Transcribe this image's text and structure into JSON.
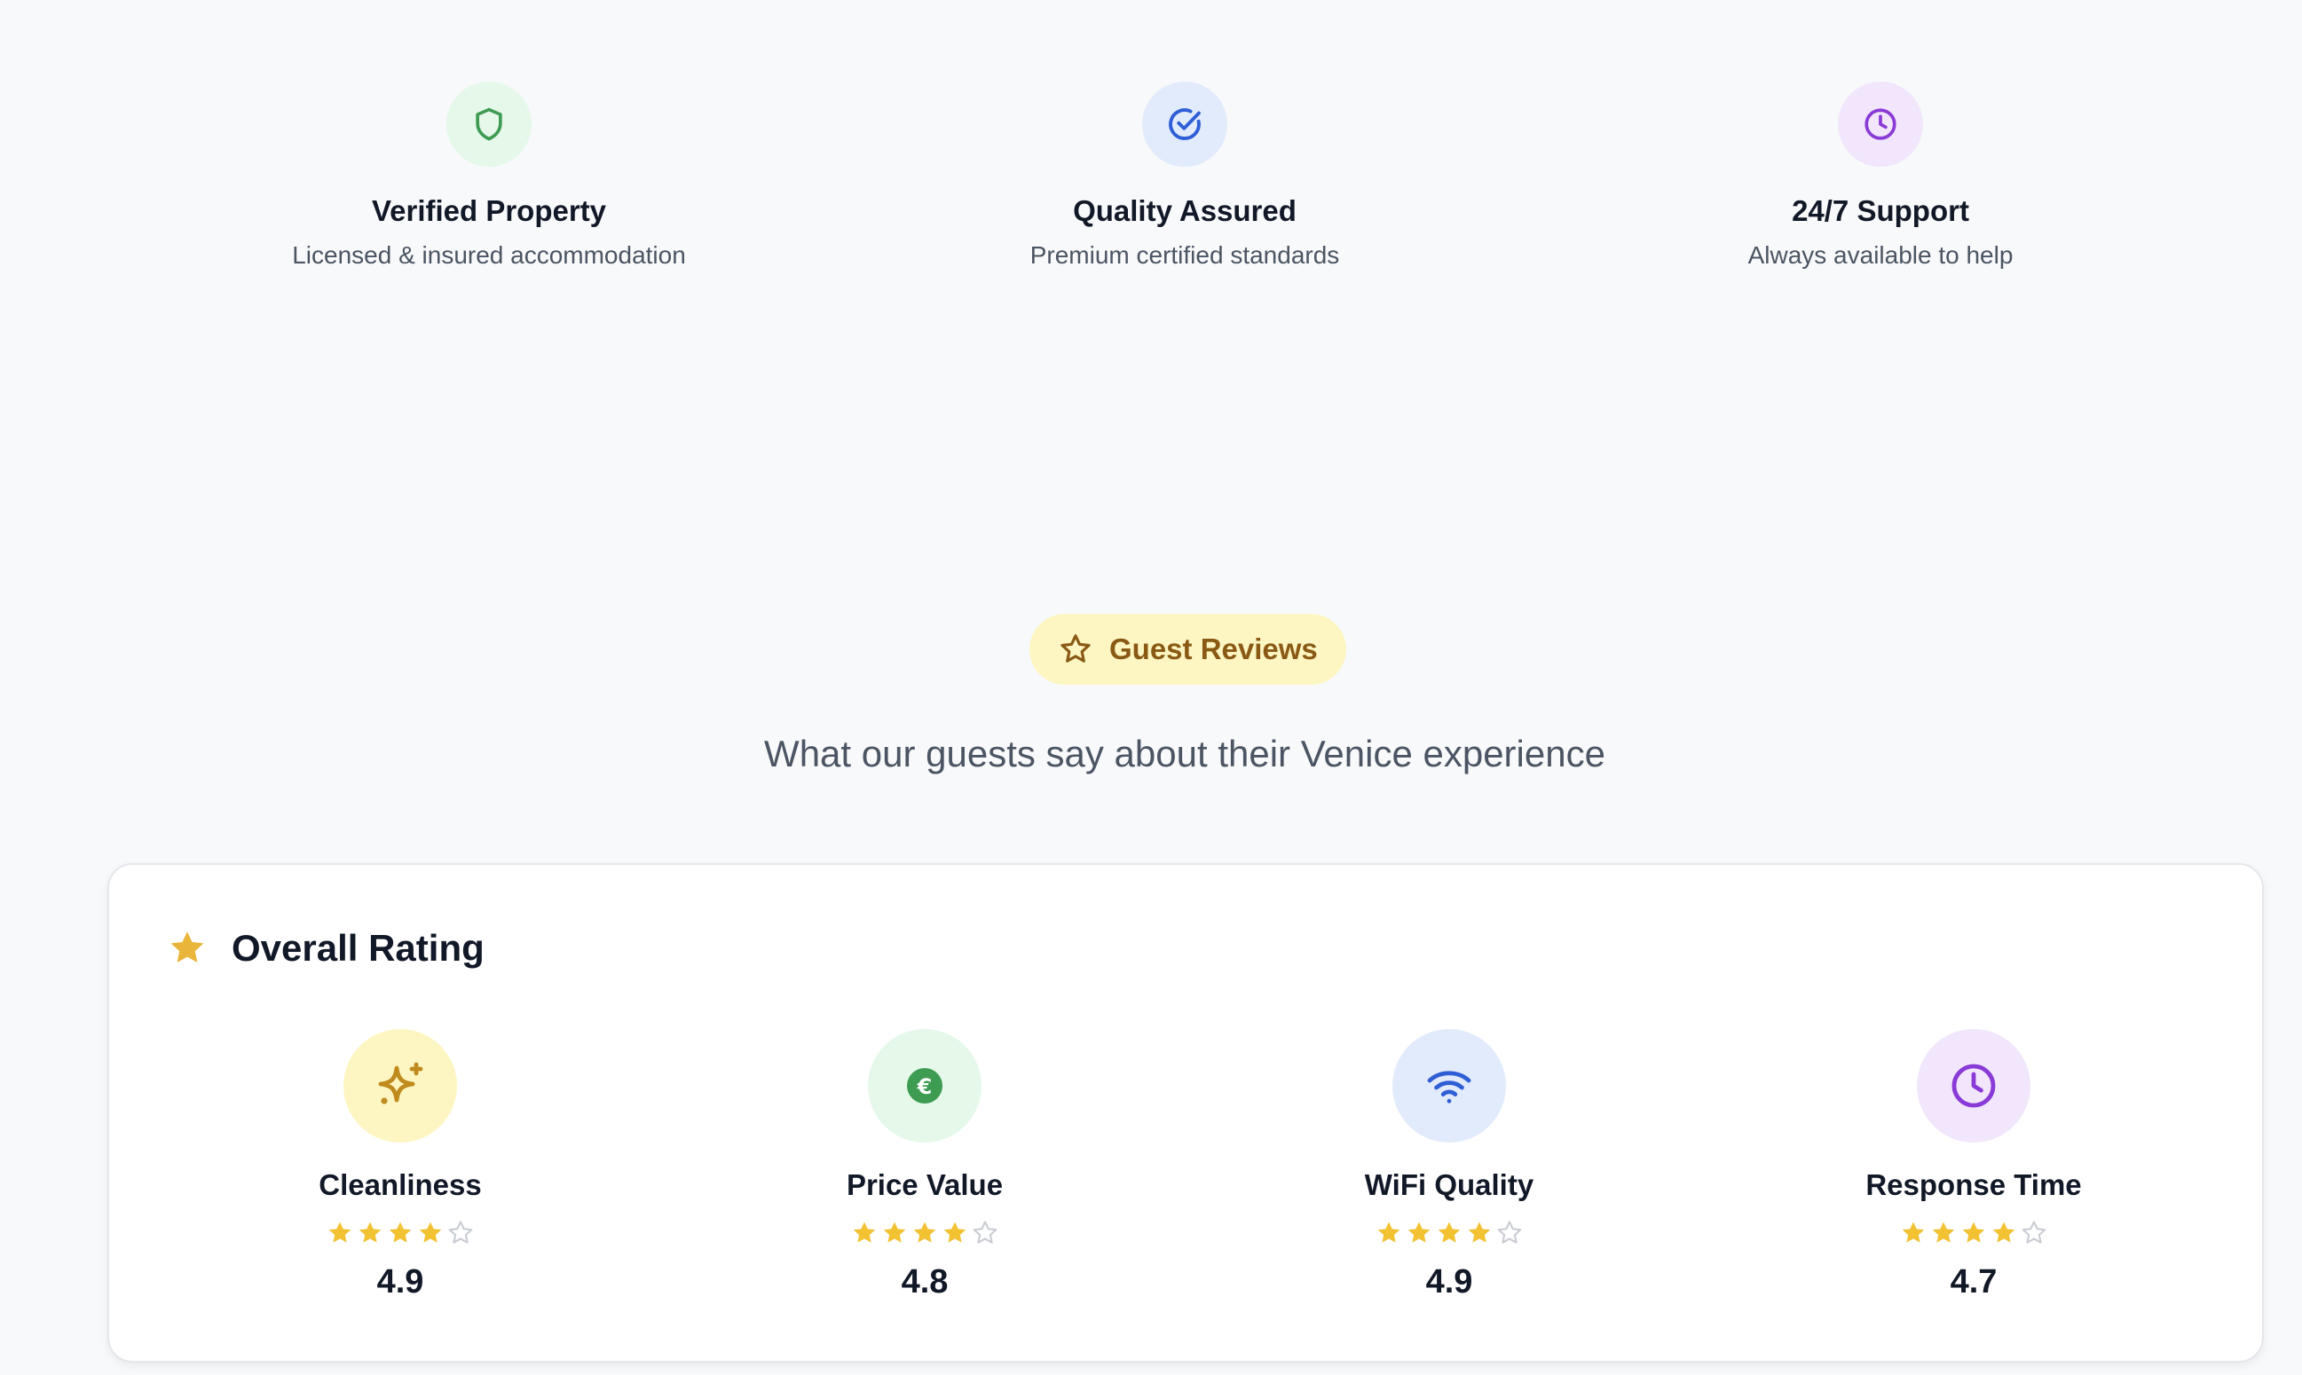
{
  "features": [
    {
      "title": "Verified Property",
      "description": "Licensed & insured accommodation",
      "icon": "shield-icon",
      "icon_bg": "#e5f8ea",
      "icon_color": "#3e9b52"
    },
    {
      "title": "Quality Assured",
      "description": "Premium certified standards",
      "icon": "check-circle-icon",
      "icon_bg": "#e2ebfc",
      "icon_color": "#2f5fd6"
    },
    {
      "title": "24/7 Support",
      "description": "Always available to help",
      "icon": "clock-icon",
      "icon_bg": "#f1e6fb",
      "icon_color": "#8a3ad6"
    }
  ],
  "reviews": {
    "badge_label": "Guest Reviews",
    "badge_icon": "star-outline-icon",
    "subtitle": "What our guests say about their Venice experience"
  },
  "overall_rating": {
    "title": "Overall Rating",
    "icon": "star-icon",
    "star_color": "#f2c233",
    "metrics": [
      {
        "label": "Cleanliness",
        "score": "4.9",
        "stars_filled": 4,
        "stars_total": 5,
        "icon": "sparkle-icon",
        "icon_bg": "#fdf6c3",
        "icon_color": "#c08a1c"
      },
      {
        "label": "Price Value",
        "score": "4.8",
        "stars_filled": 4,
        "stars_total": 5,
        "icon": "euro-icon",
        "icon_bg": "#e5f8ea",
        "icon_color": "#3e9b52"
      },
      {
        "label": "WiFi Quality",
        "score": "4.9",
        "stars_filled": 4,
        "stars_total": 5,
        "icon": "wifi-icon",
        "icon_bg": "#e2ebfc",
        "icon_color": "#2f5fd6"
      },
      {
        "label": "Response Time",
        "score": "4.7",
        "stars_filled": 4,
        "stars_total": 5,
        "icon": "clock-icon",
        "icon_bg": "#f1e6fb",
        "icon_color": "#8a3ad6"
      }
    ]
  }
}
